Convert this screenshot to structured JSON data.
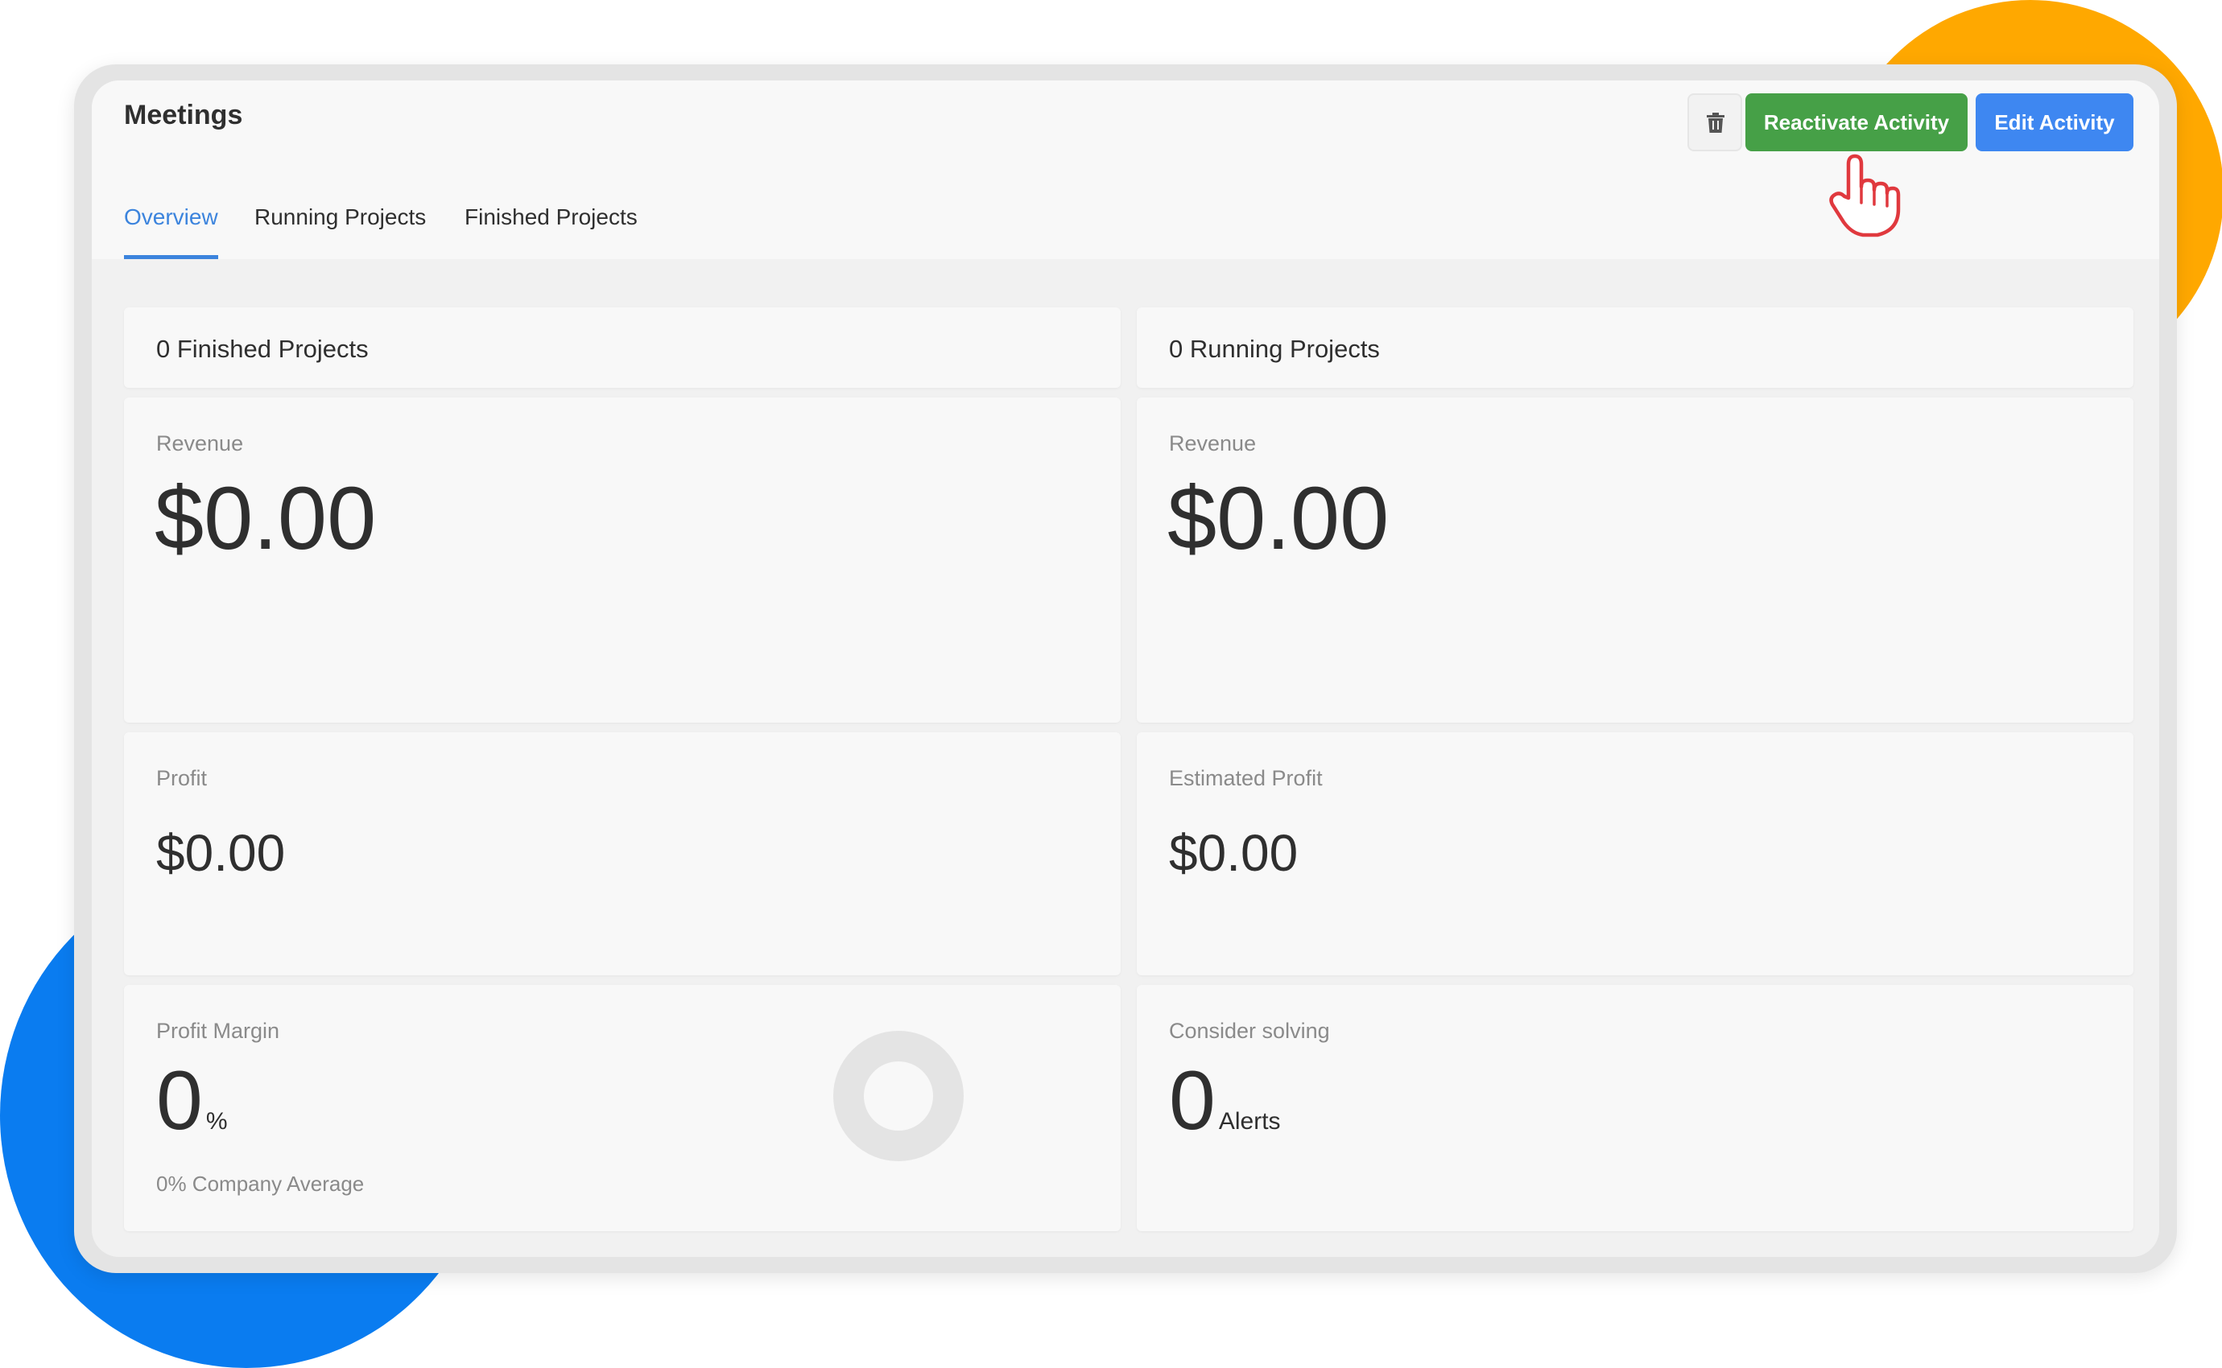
{
  "header": {
    "title": "Meetings",
    "tabs": [
      {
        "label": "Overview",
        "active": true
      },
      {
        "label": "Running Projects",
        "active": false
      },
      {
        "label": "Finished Projects",
        "active": false
      }
    ]
  },
  "actions": {
    "delete_icon": "trash-icon",
    "reactivate_label": "Reactivate Activity",
    "edit_label": "Edit Activity"
  },
  "finished": {
    "summary": "0 Finished Projects",
    "revenue_label": "Revenue",
    "revenue_value": "$0.00",
    "profit_label": "Profit",
    "profit_value": "$0.00",
    "margin_label": "Profit Margin",
    "margin_value": "0",
    "margin_unit": "%",
    "company_average": "0% Company Average",
    "margin_fraction": 0
  },
  "running": {
    "summary": "0 Running Projects",
    "revenue_label": "Revenue",
    "revenue_value": "$0.00",
    "profit_label": "Estimated Profit",
    "profit_value": "$0.00",
    "alerts_label": "Consider solving",
    "alerts_value": "0",
    "alerts_unit": "Alerts"
  },
  "colors": {
    "accent_blue": "#3C84DD",
    "reactivate_green": "#46A047",
    "edit_blue": "#3E87F1",
    "decor_orange": "#FFA800",
    "decor_blue": "#0A7CF0"
  },
  "cursor_icon": "hand-pointer-icon"
}
